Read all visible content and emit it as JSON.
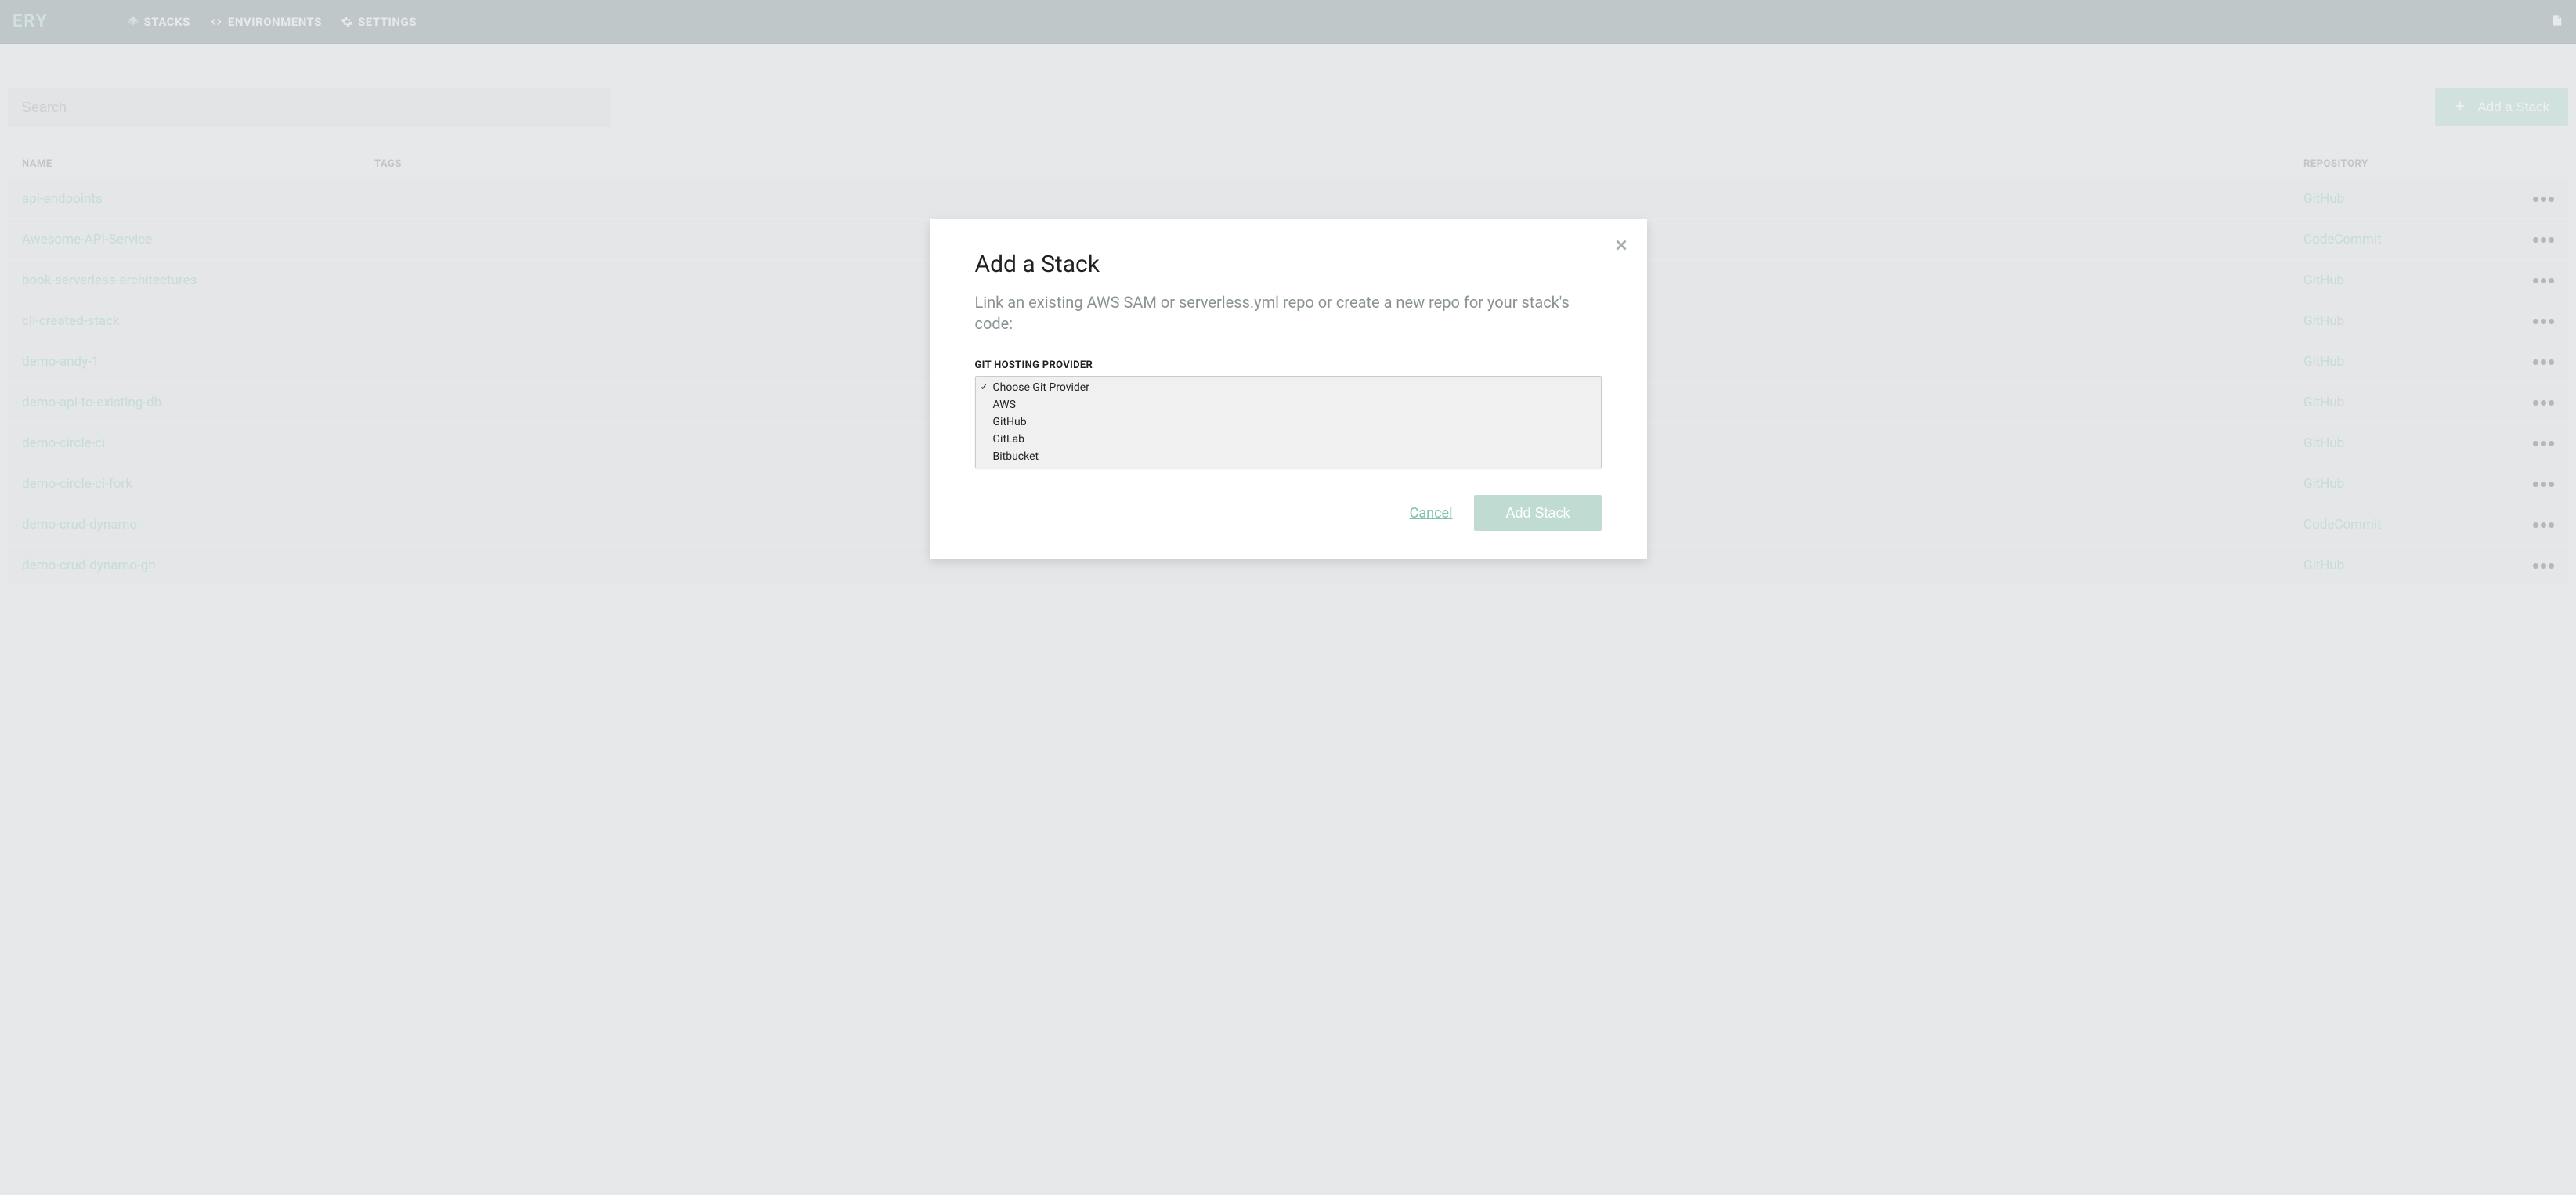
{
  "brand": "ERY",
  "nav": {
    "stacks": "STACKS",
    "environments": "ENVIRONMENTS",
    "settings": "SETTINGS"
  },
  "toolbar": {
    "search_placeholder": "Search",
    "add_stack_label": "Add a Stack"
  },
  "table": {
    "headers": {
      "name": "NAME",
      "tags": "TAGS",
      "repository": "REPOSITORY"
    },
    "rows": [
      {
        "name": "api-endpoints",
        "repo": "GitHub"
      },
      {
        "name": "Awesome-API-Service",
        "repo": "CodeCommit"
      },
      {
        "name": "book-serverless-architectures",
        "repo": "GitHub"
      },
      {
        "name": "cli-created-stack",
        "repo": "GitHub"
      },
      {
        "name": "demo-andy-1",
        "repo": "GitHub"
      },
      {
        "name": "demo-api-to-existing-db",
        "repo": "GitHub"
      },
      {
        "name": "demo-circle-ci",
        "repo": "GitHub"
      },
      {
        "name": "demo-circle-ci-fork",
        "repo": "GitHub"
      },
      {
        "name": "demo-crud-dynamo",
        "repo": "CodeCommit"
      },
      {
        "name": "demo-crud-dynamo-gh",
        "repo": "GitHub"
      }
    ]
  },
  "modal": {
    "title": "Add a Stack",
    "description": "Link an existing AWS SAM or serverless.yml repo or create a new repo for your stack's code:",
    "field_label": "GIT HOSTING PROVIDER",
    "options": [
      "Choose Git Provider",
      "AWS",
      "GitHub",
      "GitLab",
      "Bitbucket"
    ],
    "selected_index": 0,
    "cancel": "Cancel",
    "submit": "Add Stack"
  }
}
